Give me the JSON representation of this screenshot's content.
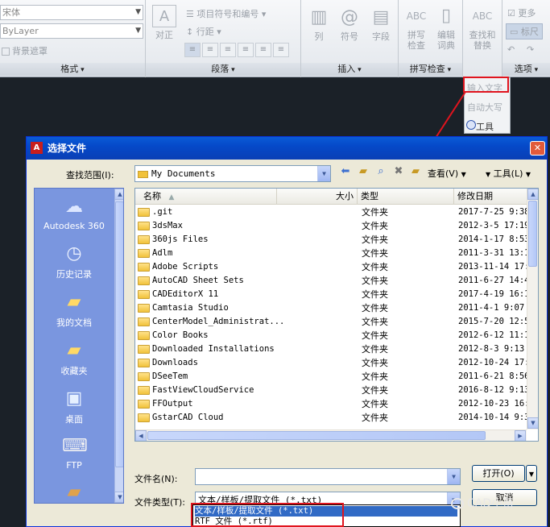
{
  "ribbon": {
    "format": {
      "font_combo": "宋体",
      "color_combo": "ByLayer",
      "mask_label": "背景遮罩",
      "title": "格式"
    },
    "paragraph": {
      "justify_label": "对正",
      "bullets_label": "项目符号和编号",
      "linespace_label": "行距",
      "title": "段落"
    },
    "insert": {
      "columns_label": "列",
      "symbol_label": "符号",
      "field_label": "字段",
      "title": "插入"
    },
    "spellcheck": {
      "spell_label1": "拼写",
      "spell_label2": "检查",
      "dict_label1": "编辑",
      "dict_label2": "词典",
      "title": "拼写检查"
    },
    "tools": {
      "find_label1": "查找和",
      "find_label2": "替换"
    },
    "options": {
      "more_label": "更多",
      "ruler_label": "标尺",
      "title": "选项"
    }
  },
  "tools_menu": {
    "items": [
      "输入文字",
      "自动大写",
      "工具"
    ]
  },
  "dialog": {
    "title": "选择文件",
    "look_in_label": "查找范围(I):",
    "look_in_value": "My Documents",
    "view_menu": "查看(V)",
    "tools_menu": "工具(L)",
    "places": [
      "Autodesk 360",
      "历史记录",
      "我的文档",
      "收藏夹",
      "桌面",
      "FTP"
    ],
    "columns": [
      "名称",
      "大小",
      "类型",
      "修改日期"
    ],
    "files": [
      {
        "name": ".git",
        "type": "文件夹",
        "date": "2017-7-25 9:38"
      },
      {
        "name": "3dsMax",
        "type": "文件夹",
        "date": "2012-3-5 17:19"
      },
      {
        "name": "360js Files",
        "type": "文件夹",
        "date": "2014-1-17 8:53"
      },
      {
        "name": "Adlm",
        "type": "文件夹",
        "date": "2011-3-31 13:11"
      },
      {
        "name": "Adobe Scripts",
        "type": "文件夹",
        "date": "2013-11-14 17:"
      },
      {
        "name": "AutoCAD Sheet Sets",
        "type": "文件夹",
        "date": "2011-6-27 14:4"
      },
      {
        "name": "CADEditorX 11",
        "type": "文件夹",
        "date": "2017-4-19 16:1"
      },
      {
        "name": "Camtasia Studio",
        "type": "文件夹",
        "date": "2011-4-1 9:07"
      },
      {
        "name": "CenterModel_Administrat...",
        "type": "文件夹",
        "date": "2015-7-20 12:5"
      },
      {
        "name": "Color Books",
        "type": "文件夹",
        "date": "2012-6-12 11:1"
      },
      {
        "name": "Downloaded Installations",
        "type": "文件夹",
        "date": "2012-8-3 9:13"
      },
      {
        "name": "Downloads",
        "type": "文件夹",
        "date": "2012-10-24 17:"
      },
      {
        "name": "DSeeTem",
        "type": "文件夹",
        "date": "2011-6-21 8:56"
      },
      {
        "name": "FastViewCloudService",
        "type": "文件夹",
        "date": "2016-8-12 9:13"
      },
      {
        "name": "FFOutput",
        "type": "文件夹",
        "date": "2012-10-23 16:"
      },
      {
        "name": "GstarCAD Cloud",
        "type": "文件夹",
        "date": "2014-10-14 9:3"
      }
    ],
    "filename_label": "文件名(N):",
    "filename_value": "",
    "filetype_label": "文件类型(T):",
    "filetype_value": "文本/样板/提取文件 (*.txt)",
    "open_button": "打开(O)",
    "cancel_button": "取消",
    "filetype_options": [
      "文本/样板/提取文件 (*.txt)",
      "RTF 文件 (*.rtf)"
    ]
  },
  "watermark": "CAD小苗",
  "colors": {
    "highlight_red": "#e0141e",
    "xp_title_blue": "#0a5bd6",
    "places_blue": "#7a96df"
  }
}
